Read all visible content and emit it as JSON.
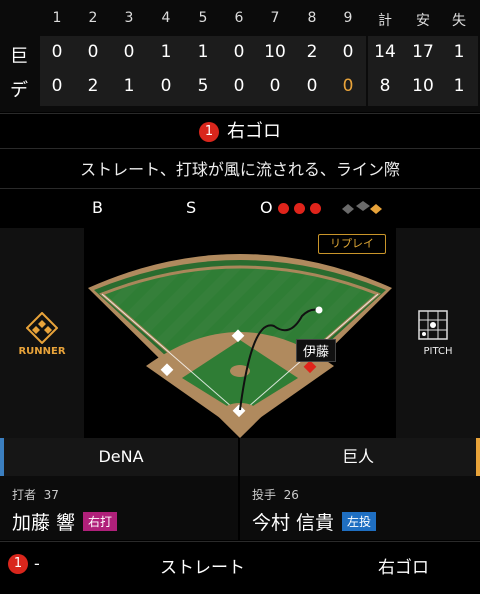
{
  "scoreboard": {
    "headers": [
      "1",
      "2",
      "3",
      "4",
      "5",
      "6",
      "7",
      "8",
      "9",
      "計",
      "安",
      "失"
    ],
    "teams": [
      {
        "name": "巨",
        "scores": [
          "0",
          "0",
          "0",
          "1",
          "1",
          "0",
          "10",
          "2",
          "0"
        ],
        "totals": [
          "14",
          "17",
          "1"
        ]
      },
      {
        "name": "デ",
        "scores": [
          "0",
          "2",
          "1",
          "0",
          "5",
          "0",
          "0",
          "0",
          "0"
        ],
        "totals": [
          "8",
          "10",
          "1"
        ]
      }
    ]
  },
  "play": {
    "number": "1",
    "result": "右ゴロ",
    "description": "ストレート、打球が風に流される、ライン際"
  },
  "count": {
    "b_label": "B",
    "s_label": "S",
    "o_label": "O",
    "outs": 3
  },
  "field": {
    "replay_label": "リプレイ",
    "runner_label": "RUNNER",
    "pitch_label": "PITCH",
    "fielder_label": "伊藤"
  },
  "teams": {
    "left": "DeNA",
    "right": "巨人"
  },
  "batter": {
    "role": "打者",
    "number": "37",
    "name": "加藤 響",
    "tag": "右打"
  },
  "pitcher": {
    "role": "投手",
    "number": "26",
    "name": "今村 信貴",
    "tag": "左投"
  },
  "pitch_row": {
    "number": "1",
    "dash": "-",
    "pitch": "ストレート",
    "result": "右ゴロ"
  },
  "colors": {
    "accent_orange": "#e8a33a",
    "batter_tag": "#b0207a",
    "pitcher_tag": "#1f6fc2",
    "out_red": "#e0241b"
  }
}
